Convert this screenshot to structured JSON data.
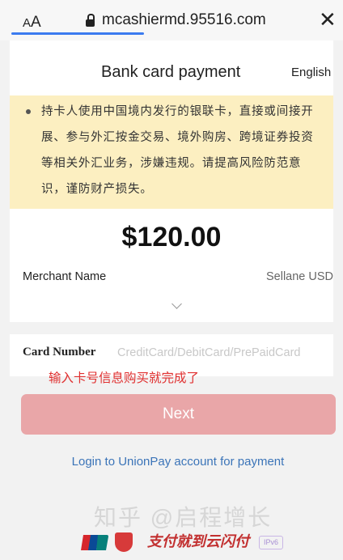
{
  "browser": {
    "text_size_label_small": "A",
    "text_size_label_big": "A",
    "url": "mcashiermd.95516.com",
    "close_glyph": "✕"
  },
  "header": {
    "title": "Bank card payment",
    "language": "English"
  },
  "notice": {
    "text": "持卡人使用中国境内发行的银联卡，直接或间接开展、参与外汇按金交易、境外购房、跨境证券投资等相关外汇业务，涉嫌违规。请提高风险防范意识，谨防财产损失。"
  },
  "payment": {
    "amount": "$120.00",
    "merchant_label": "Merchant Name",
    "merchant_value": "Sellane USD"
  },
  "card": {
    "label": "Card Number",
    "placeholder": "CreditCard/DebitCard/PrePaidCard",
    "value": ""
  },
  "annotation": "输入卡号信息购买就完成了",
  "actions": {
    "next_label": "Next",
    "login_link": "Login to UnionPay account for payment"
  },
  "watermark": "知乎 @启程增长",
  "footer": {
    "signature_text": "支付就到云闪付",
    "ipv6_badge": "IPv6"
  },
  "colors": {
    "notice_bg": "#fcefc1",
    "next_button": "#e9a6a8",
    "link": "#3b74b8",
    "annotation": "#e03030",
    "progress": "#3b7bf0"
  }
}
